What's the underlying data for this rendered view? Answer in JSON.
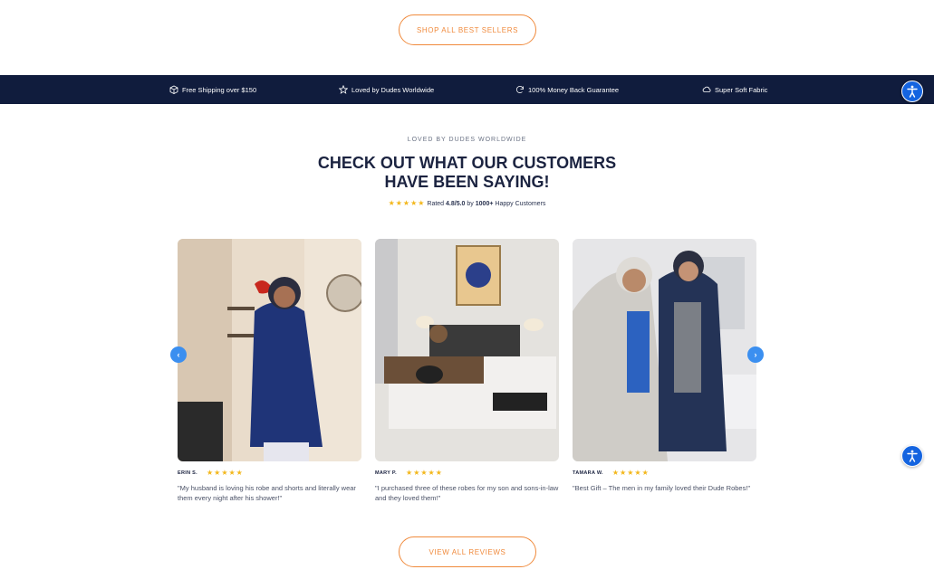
{
  "buttons": {
    "shop_all": "SHOP ALL BEST SELLERS",
    "view_reviews": "VIEW ALL REVIEWS"
  },
  "features": [
    {
      "icon": "box-icon",
      "label": "Free Shipping over $150"
    },
    {
      "icon": "star-outline-icon",
      "label": "Loved by Dudes Worldwide"
    },
    {
      "icon": "refresh-icon",
      "label": "100% Money Back Guarantee"
    },
    {
      "icon": "cloud-icon",
      "label": "Super Soft Fabric"
    }
  ],
  "section": {
    "eyebrow": "LOVED BY DUDES WORLDWIDE",
    "heading_line1": "CHECK OUT WHAT OUR CUSTOMERS",
    "heading_line2": "HAVE BEEN SAYING!",
    "stars": "★★★★★",
    "rating_prefix": "Rated",
    "rating_value": "4.8/5.0",
    "rating_mid": "by",
    "rating_count": "1000+",
    "rating_suffix": "Happy Customers"
  },
  "reviews": [
    {
      "name": "ERIN S.",
      "stars": "★★★★★",
      "quote": "\"My husband is loving his robe and shorts and literally wear them every night after his shower!\""
    },
    {
      "name": "MARY P.",
      "stars": "★★★★★",
      "quote": "\"I purchased three of these robes for my son and sons-in-law and they loved them!\""
    },
    {
      "name": "TAMARA W.",
      "stars": "★★★★★",
      "quote": "\"Best Gift – The men in my family loved their Dude Robes!\""
    }
  ],
  "carousel": {
    "prev_icon": "chevron-left-icon",
    "next_icon": "chevron-right-icon"
  },
  "colors": {
    "navy": "#101c3d",
    "accent": "#f08a3c",
    "star": "#f3b71b",
    "a11y": "#1464e0"
  }
}
